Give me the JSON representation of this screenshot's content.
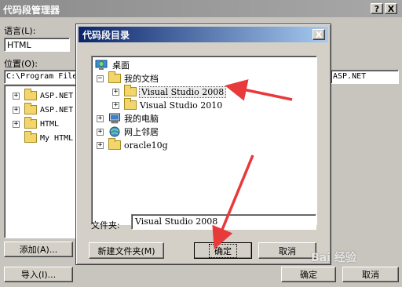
{
  "outer": {
    "title": "代码段管理器",
    "help_btn": "?",
    "close_btn": "X",
    "language_label": "语言(L):",
    "language_value": "HTML",
    "location_label": "位置(O):",
    "location_value": "C:\\Program File",
    "location_right": "ASP.NET",
    "tree": [
      "ASP.NET",
      "ASP.NET",
      "HTML",
      "My HTML"
    ],
    "add_btn": "添加(A)...",
    "import_btn": "导入(I)...",
    "ok_btn": "确定",
    "cancel_btn": "取消"
  },
  "modal": {
    "title": "代码段目录",
    "close_btn": "X",
    "tree": {
      "desktop": "桌面",
      "my_documents": "我的文档",
      "vs2008": "Visual Studio 2008",
      "vs2010": "Visual Studio 2010",
      "my_computer": "我的电脑",
      "network": "网上邻居",
      "oracle": "oracle10g"
    },
    "folder_label": "文件夹:",
    "folder_value": "Visual Studio 2008",
    "new_folder_btn": "新建文件夹(M)",
    "ok_btn": "确定",
    "cancel_btn": "取消"
  },
  "watermark": "Bai 经验",
  "colors": {
    "arrow": "#e8393b",
    "title_active": "#0a246a"
  }
}
